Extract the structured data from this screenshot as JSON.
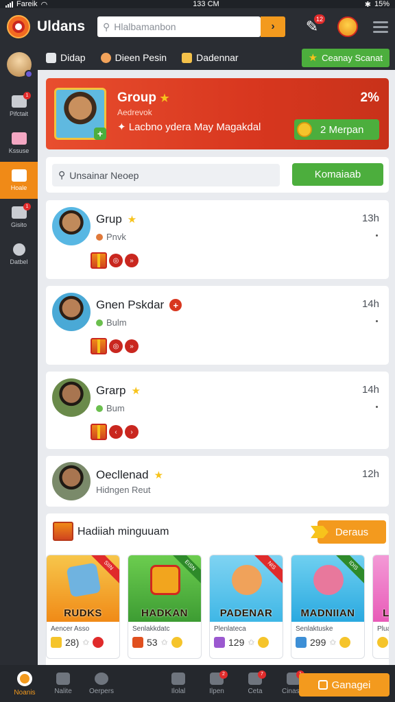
{
  "status_bar": {
    "carrier": "Fareik",
    "time": "133 CM",
    "battery": "15%"
  },
  "app": {
    "name": "Uldans"
  },
  "search": {
    "placeholder": "Hlalbamanbon",
    "go_icon": "arrow-right-icon"
  },
  "appbar": {
    "notif_badge": "12"
  },
  "sidebar": {
    "items": [
      {
        "label": "Pifctait",
        "badge": "1",
        "icon": "eraser-icon"
      },
      {
        "label": "Kssuse",
        "badge": "",
        "icon": "bag-icon"
      },
      {
        "label": "Hoale",
        "badge": "",
        "icon": "gift-icon",
        "active": true
      },
      {
        "label": "Gisito",
        "badge": "1",
        "icon": "eraser-icon"
      },
      {
        "label": "Datbel",
        "badge": "",
        "icon": "gear-icon"
      }
    ]
  },
  "topnav": {
    "tabs": [
      {
        "label": "Didap",
        "icon": "gallery-icon"
      },
      {
        "label": "Dieen Pesin",
        "icon": "face-icon"
      },
      {
        "label": "Dadennar",
        "icon": "cake-icon"
      }
    ],
    "cta": "Ceanay Scanat"
  },
  "banner": {
    "title": "Group",
    "subtitle": "Aedrevok",
    "desc": "Lacbno ydera May Magakdal",
    "percent": "2%",
    "button": "2 Merpan"
  },
  "panel_search": {
    "placeholder": "Unsainar Neoep",
    "button": "Komaiaab"
  },
  "chats": [
    {
      "name": "Grup",
      "badge": "star",
      "sub": "Pnvk",
      "time": "13h"
    },
    {
      "name": "Gnen Pskdar",
      "badge": "plus",
      "sub": "Bulm",
      "time": "14h"
    },
    {
      "name": "Grarp",
      "badge": "star",
      "sub": "Bum",
      "time": "14h"
    },
    {
      "name": "Oecllenad",
      "badge": "star",
      "sub": "Hidngen Reut",
      "time": "12h"
    }
  ],
  "gifts": {
    "title": "Hadiiah minguuam",
    "button": "Deraus",
    "items": [
      {
        "name": "RUDKS",
        "sub": "Aencer Asso",
        "count": "28)",
        "ribbon": "SIIN",
        "color": "#f5a623"
      },
      {
        "name": "HADKAN",
        "sub": "Senlakkdatc",
        "count": "53",
        "ribbon": "EISN",
        "color": "#4cae3d"
      },
      {
        "name": "PADENAR",
        "sub": "Plenlateca",
        "count": "129",
        "ribbon": "NIS",
        "color": "#3fb7e6"
      },
      {
        "name": "MADNIIAN",
        "sub": "Senlaktuske",
        "count": "299",
        "ribbon": "IDIS",
        "color": "#2aa9e0"
      },
      {
        "name": "L",
        "sub": "Plua",
        "count": "",
        "ribbon": "",
        "color": "#e85bb8"
      }
    ]
  },
  "bottomnav": {
    "items": [
      {
        "label": "Noanis",
        "active": true,
        "badge": ""
      },
      {
        "label": "Nalite",
        "badge": ""
      },
      {
        "label": "Oerpers",
        "badge": ""
      },
      {
        "label": "",
        "badge": ""
      },
      {
        "label": "Ilolal",
        "badge": ""
      },
      {
        "label": "Ilpen",
        "badge": "2"
      },
      {
        "label": "Ceta",
        "badge": "7"
      },
      {
        "label": "Cinaset",
        "badge": "1"
      }
    ],
    "cta": "Ganagei"
  }
}
